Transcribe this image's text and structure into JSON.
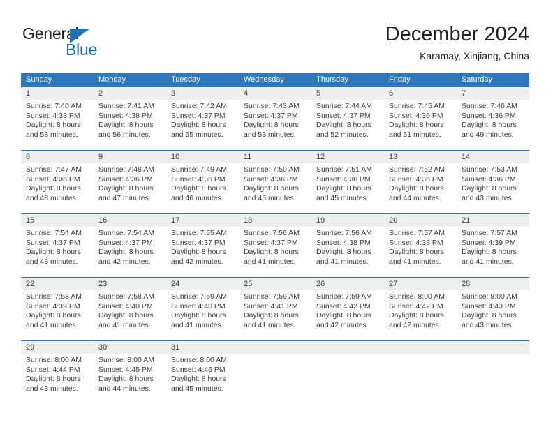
{
  "brand": {
    "name_top": "General",
    "name_bottom": "Blue",
    "accent_color": "#1d72b8",
    "triangle_icon": "triangle-icon"
  },
  "header": {
    "title": "December 2024",
    "subtitle": "Karamay, Xinjiang, China"
  },
  "calendar": {
    "header_bg": "#2e77b8",
    "daynum_bg": "#efeff0",
    "weekdays": [
      "Sunday",
      "Monday",
      "Tuesday",
      "Wednesday",
      "Thursday",
      "Friday",
      "Saturday"
    ],
    "weeks": [
      [
        {
          "day": "1",
          "sunrise": "Sunrise: 7:40 AM",
          "sunset": "Sunset: 4:38 PM",
          "daylight1": "Daylight: 8 hours",
          "daylight2": "and 58 minutes."
        },
        {
          "day": "2",
          "sunrise": "Sunrise: 7:41 AM",
          "sunset": "Sunset: 4:38 PM",
          "daylight1": "Daylight: 8 hours",
          "daylight2": "and 56 minutes."
        },
        {
          "day": "3",
          "sunrise": "Sunrise: 7:42 AM",
          "sunset": "Sunset: 4:37 PM",
          "daylight1": "Daylight: 8 hours",
          "daylight2": "and 55 minutes."
        },
        {
          "day": "4",
          "sunrise": "Sunrise: 7:43 AM",
          "sunset": "Sunset: 4:37 PM",
          "daylight1": "Daylight: 8 hours",
          "daylight2": "and 53 minutes."
        },
        {
          "day": "5",
          "sunrise": "Sunrise: 7:44 AM",
          "sunset": "Sunset: 4:37 PM",
          "daylight1": "Daylight: 8 hours",
          "daylight2": "and 52 minutes."
        },
        {
          "day": "6",
          "sunrise": "Sunrise: 7:45 AM",
          "sunset": "Sunset: 4:36 PM",
          "daylight1": "Daylight: 8 hours",
          "daylight2": "and 51 minutes."
        },
        {
          "day": "7",
          "sunrise": "Sunrise: 7:46 AM",
          "sunset": "Sunset: 4:36 PM",
          "daylight1": "Daylight: 8 hours",
          "daylight2": "and 49 minutes."
        }
      ],
      [
        {
          "day": "8",
          "sunrise": "Sunrise: 7:47 AM",
          "sunset": "Sunset: 4:36 PM",
          "daylight1": "Daylight: 8 hours",
          "daylight2": "and 48 minutes."
        },
        {
          "day": "9",
          "sunrise": "Sunrise: 7:48 AM",
          "sunset": "Sunset: 4:36 PM",
          "daylight1": "Daylight: 8 hours",
          "daylight2": "and 47 minutes."
        },
        {
          "day": "10",
          "sunrise": "Sunrise: 7:49 AM",
          "sunset": "Sunset: 4:36 PM",
          "daylight1": "Daylight: 8 hours",
          "daylight2": "and 46 minutes."
        },
        {
          "day": "11",
          "sunrise": "Sunrise: 7:50 AM",
          "sunset": "Sunset: 4:36 PM",
          "daylight1": "Daylight: 8 hours",
          "daylight2": "and 45 minutes."
        },
        {
          "day": "12",
          "sunrise": "Sunrise: 7:51 AM",
          "sunset": "Sunset: 4:36 PM",
          "daylight1": "Daylight: 8 hours",
          "daylight2": "and 45 minutes."
        },
        {
          "day": "13",
          "sunrise": "Sunrise: 7:52 AM",
          "sunset": "Sunset: 4:36 PM",
          "daylight1": "Daylight: 8 hours",
          "daylight2": "and 44 minutes."
        },
        {
          "day": "14",
          "sunrise": "Sunrise: 7:53 AM",
          "sunset": "Sunset: 4:36 PM",
          "daylight1": "Daylight: 8 hours",
          "daylight2": "and 43 minutes."
        }
      ],
      [
        {
          "day": "15",
          "sunrise": "Sunrise: 7:54 AM",
          "sunset": "Sunset: 4:37 PM",
          "daylight1": "Daylight: 8 hours",
          "daylight2": "and 43 minutes."
        },
        {
          "day": "16",
          "sunrise": "Sunrise: 7:54 AM",
          "sunset": "Sunset: 4:37 PM",
          "daylight1": "Daylight: 8 hours",
          "daylight2": "and 42 minutes."
        },
        {
          "day": "17",
          "sunrise": "Sunrise: 7:55 AM",
          "sunset": "Sunset: 4:37 PM",
          "daylight1": "Daylight: 8 hours",
          "daylight2": "and 42 minutes."
        },
        {
          "day": "18",
          "sunrise": "Sunrise: 7:56 AM",
          "sunset": "Sunset: 4:37 PM",
          "daylight1": "Daylight: 8 hours",
          "daylight2": "and 41 minutes."
        },
        {
          "day": "19",
          "sunrise": "Sunrise: 7:56 AM",
          "sunset": "Sunset: 4:38 PM",
          "daylight1": "Daylight: 8 hours",
          "daylight2": "and 41 minutes."
        },
        {
          "day": "20",
          "sunrise": "Sunrise: 7:57 AM",
          "sunset": "Sunset: 4:38 PM",
          "daylight1": "Daylight: 8 hours",
          "daylight2": "and 41 minutes."
        },
        {
          "day": "21",
          "sunrise": "Sunrise: 7:57 AM",
          "sunset": "Sunset: 4:39 PM",
          "daylight1": "Daylight: 8 hours",
          "daylight2": "and 41 minutes."
        }
      ],
      [
        {
          "day": "22",
          "sunrise": "Sunrise: 7:58 AM",
          "sunset": "Sunset: 4:39 PM",
          "daylight1": "Daylight: 8 hours",
          "daylight2": "and 41 minutes."
        },
        {
          "day": "23",
          "sunrise": "Sunrise: 7:58 AM",
          "sunset": "Sunset: 4:40 PM",
          "daylight1": "Daylight: 8 hours",
          "daylight2": "and 41 minutes."
        },
        {
          "day": "24",
          "sunrise": "Sunrise: 7:59 AM",
          "sunset": "Sunset: 4:40 PM",
          "daylight1": "Daylight: 8 hours",
          "daylight2": "and 41 minutes."
        },
        {
          "day": "25",
          "sunrise": "Sunrise: 7:59 AM",
          "sunset": "Sunset: 4:41 PM",
          "daylight1": "Daylight: 8 hours",
          "daylight2": "and 41 minutes."
        },
        {
          "day": "26",
          "sunrise": "Sunrise: 7:59 AM",
          "sunset": "Sunset: 4:42 PM",
          "daylight1": "Daylight: 8 hours",
          "daylight2": "and 42 minutes."
        },
        {
          "day": "27",
          "sunrise": "Sunrise: 8:00 AM",
          "sunset": "Sunset: 4:42 PM",
          "daylight1": "Daylight: 8 hours",
          "daylight2": "and 42 minutes."
        },
        {
          "day": "28",
          "sunrise": "Sunrise: 8:00 AM",
          "sunset": "Sunset: 4:43 PM",
          "daylight1": "Daylight: 8 hours",
          "daylight2": "and 43 minutes."
        }
      ],
      [
        {
          "day": "29",
          "sunrise": "Sunrise: 8:00 AM",
          "sunset": "Sunset: 4:44 PM",
          "daylight1": "Daylight: 8 hours",
          "daylight2": "and 43 minutes."
        },
        {
          "day": "30",
          "sunrise": "Sunrise: 8:00 AM",
          "sunset": "Sunset: 4:45 PM",
          "daylight1": "Daylight: 8 hours",
          "daylight2": "and 44 minutes."
        },
        {
          "day": "31",
          "sunrise": "Sunrise: 8:00 AM",
          "sunset": "Sunset: 4:46 PM",
          "daylight1": "Daylight: 8 hours",
          "daylight2": "and 45 minutes."
        },
        {
          "day": "",
          "sunrise": "",
          "sunset": "",
          "daylight1": "",
          "daylight2": ""
        },
        {
          "day": "",
          "sunrise": "",
          "sunset": "",
          "daylight1": "",
          "daylight2": ""
        },
        {
          "day": "",
          "sunrise": "",
          "sunset": "",
          "daylight1": "",
          "daylight2": ""
        },
        {
          "day": "",
          "sunrise": "",
          "sunset": "",
          "daylight1": "",
          "daylight2": ""
        }
      ]
    ]
  }
}
